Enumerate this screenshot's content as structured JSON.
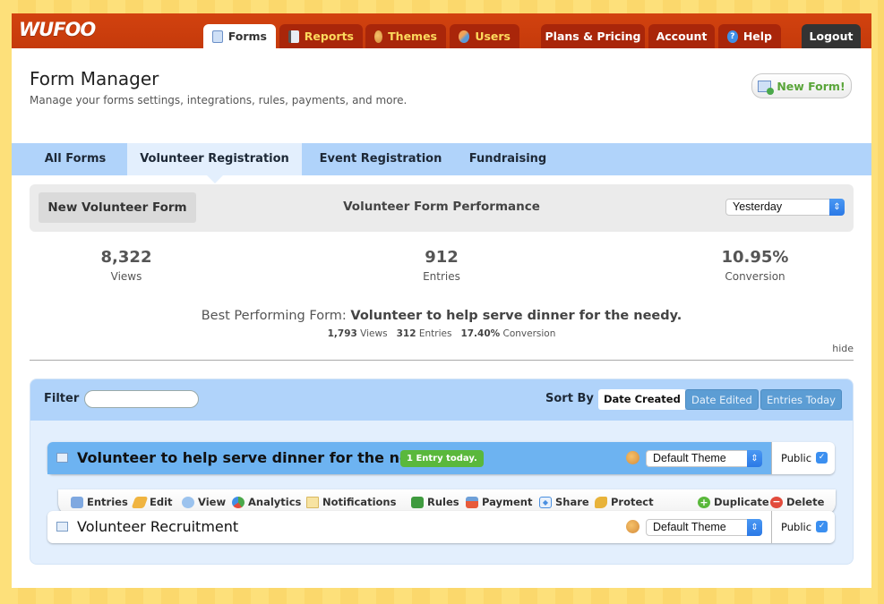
{
  "app": {
    "logo": "WUFOO"
  },
  "nav": {
    "tabs": [
      {
        "label": "Forms",
        "icon": "forms-icon",
        "active": true
      },
      {
        "label": "Reports",
        "icon": "reports-icon"
      },
      {
        "label": "Themes",
        "icon": "themes-palette-icon"
      },
      {
        "label": "Users",
        "icon": "users-icon"
      },
      {
        "label": "Plans & Pricing"
      },
      {
        "label": "Account"
      },
      {
        "label": "Help",
        "icon": "help-icon"
      },
      {
        "label": "Logout"
      }
    ]
  },
  "header": {
    "title": "Form Manager",
    "subtitle": "Manage your forms settings, integrations, rules, payments, and more.",
    "new_form_label": "New Form!"
  },
  "form_tabs": [
    {
      "label": "All Forms"
    },
    {
      "label": "Volunteer Registration",
      "active": true
    },
    {
      "label": "Event Registration"
    },
    {
      "label": "Fundraising"
    }
  ],
  "performance": {
    "new_form_label": "New Volunteer Form",
    "title": "Volunteer Form Performance",
    "period": "Yesterday",
    "stats": [
      {
        "value": "8,322",
        "label": "Views"
      },
      {
        "value": "912",
        "label": "Entries"
      },
      {
        "value": "10.95%",
        "label": "Conversion"
      }
    ],
    "best_prefix": "Best Performing Form:",
    "best_name": "Volunteer to help serve dinner for the needy.",
    "best_views": "1,793",
    "best_views_label": "Views",
    "best_entries": "312",
    "best_entries_label": "Entries",
    "best_conversion": "17.40%",
    "best_conversion_label": "Conversion",
    "hide_label": "hide"
  },
  "list": {
    "filter_label": "Filter",
    "filter_value": "",
    "sort_label": "Sort By :",
    "sort_options": [
      {
        "label": "Date Created",
        "active": true
      },
      {
        "label": "Date Edited"
      },
      {
        "label": "Entries Today"
      }
    ],
    "forms": [
      {
        "title": "Volunteer to help serve dinner for the needy.",
        "badge": "1 Entry today.",
        "theme": "Default Theme",
        "public_label": "Public",
        "public": true,
        "selected": true
      },
      {
        "title": "Volunteer Recruitment",
        "theme": "Default Theme",
        "public_label": "Public",
        "public": true
      }
    ],
    "actions": [
      {
        "label": "Entries",
        "icon": "entries-icon",
        "color": "#5b8fd6"
      },
      {
        "label": "Edit",
        "icon": "pencil-icon",
        "color": "#f0b440"
      },
      {
        "label": "View",
        "icon": "magnifier-icon",
        "color": "#7fb2e8"
      },
      {
        "label": "Analytics",
        "icon": "analytics-pie-icon",
        "color": "#4aa84a"
      },
      {
        "label": "Notifications",
        "icon": "envelope-icon",
        "color": "#f3d27a"
      },
      {
        "label": "Rules",
        "icon": "rules-icon",
        "color": "#3f9b3f"
      },
      {
        "label": "Payment",
        "icon": "payment-card-icon",
        "color": "#e85b3a"
      },
      {
        "label": "Share",
        "icon": "share-code-icon",
        "color": "#4a8fe0"
      },
      {
        "label": "Protect",
        "icon": "key-icon",
        "color": "#e8b33a"
      },
      {
        "label": "Duplicate",
        "icon": "plus-circle-icon",
        "color": "#5ab83c"
      },
      {
        "label": "Delete",
        "icon": "minus-circle-icon",
        "color": "#e24b3c"
      }
    ]
  }
}
